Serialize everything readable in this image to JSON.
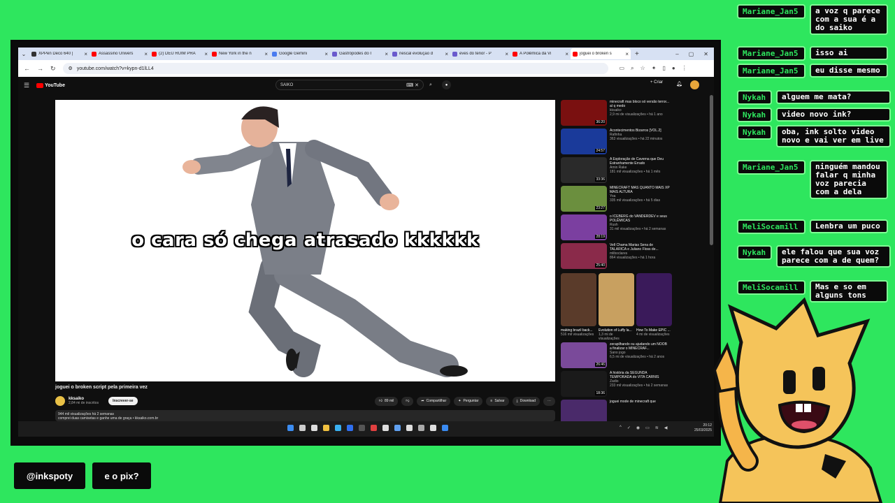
{
  "browser": {
    "tabs": [
      {
        "label": "XPPen Deco 640 |",
        "color": "#333"
      },
      {
        "label": "Assassino Univers",
        "color": "#f00"
      },
      {
        "label": "(2) DEU RUIM PRA",
        "color": "#f00"
      },
      {
        "label": "New York in the n",
        "color": "#f00"
      },
      {
        "label": "Google Gemini",
        "color": "#4a7cf0"
      },
      {
        "label": "Gastrópodes do I",
        "color": "#6a5acd"
      },
      {
        "label": "nescal evolução d",
        "color": "#6a5acd"
      },
      {
        "label": "eves do tenor - P",
        "color": "#6a5acd"
      },
      {
        "label": "A Polêmica da Vi",
        "color": "#f00"
      },
      {
        "label": "joguei o broken s",
        "color": "#f00",
        "active": true
      }
    ],
    "url": "youtube.com/watch?v=kypn-d1lLL4"
  },
  "youtube": {
    "logo_text": "YouTube",
    "search_value": "SAIKO",
    "create_label": "Criar",
    "video_caption": "o cara só chega atrasado kkkkkk",
    "video_title": "joguei o broken script pela primeira vez",
    "channel_name": "kksaiko",
    "channel_subs": "2,84 mi de inscritos",
    "subscribe_label": "Inscrever-se",
    "like_count": "89 mil",
    "share_label": "Compartilhar",
    "ask_label": "Perguntar",
    "save_label": "Salvar",
    "download_label": "Download",
    "description_line1": "944 mil visualizações  há 2 semanas",
    "description_line2": "comprei duas camisetas e ganhe uma de graça • kksaiko.com.br",
    "recommendations": [
      {
        "title": "minecraft mas bloco só versão terror... aí q medo",
        "channel": "kksaiko",
        "views": "2,9 mi de visualizações • há 1 ano",
        "thumb": "#7a1010",
        "duration": "36:20"
      },
      {
        "title": "Acontecimentos Bizarros [VOL.2]",
        "channel": "Rafinha",
        "views": "363 visualizações • há 22 minutos",
        "thumb": "#1a3a9a",
        "duration": "24:57"
      },
      {
        "title": "A Exploração de Caverna que Deu Estranhamente Errado",
        "channel": "Amin Rake",
        "views": "181 mil visualizações • há 1 mês",
        "thumb": "#2a2a2a",
        "duration": "33:36"
      },
      {
        "title": "MINECRAFT MAS QUANTO MAIS XP MAIS ALTURA",
        "channel": "Yoa",
        "views": "335 mil visualizações • há 5 dias",
        "thumb": "#6b8f3e",
        "duration": "23:27"
      },
      {
        "title": "o ICEBERG do VANDERDEV e seus POLÊMICAS",
        "channel": "Rush",
        "views": "31 mil visualizações • há 2 semanas",
        "thumb": "#7b3fa0",
        "duration": "28:19"
      },
      {
        "title": "Vell Chama Marias Sena de TALARICA e Juliano Floss de...",
        "channel": "mliboclares",
        "views": "864 visualizações • há 1 hora",
        "thumb": "#8a2a4a",
        "duration": "25:40"
      }
    ],
    "shorts": [
      {
        "title": "making brazil back...",
        "views": "516 mil visualizações",
        "thumb": "#5a3b2a"
      },
      {
        "title": "Evolution of Luffy la...",
        "views": "1,3 mi de visualizações",
        "thumb": "#c8a060"
      },
      {
        "title": "How To Make EPIC ...",
        "views": "4 mi de visualizações",
        "thumb": "#3a1a5a"
      }
    ],
    "recommendations_bottom": [
      {
        "title": "zerapilhando ou ajudando um NOOB a finalizar o MINECRAF...",
        "channel": "Sano jogo",
        "views": "6,5 mi de visualizações • há 2 anos",
        "thumb": "#7a4a9a",
        "duration": "26:46"
      },
      {
        "title": "A história da SEGUNDA TEMPORADA do VITA CARNIS",
        "channel": "Zadio",
        "views": "233 mil visualizações • há 2 semanas",
        "thumb": "#1a1a1a",
        "duration": "18:36"
      },
      {
        "title": "joguei mode de minecraft que",
        "channel": "",
        "views": "",
        "thumb": "#4a2a6a",
        "duration": ""
      }
    ]
  },
  "taskbar": {
    "time": "20:12",
    "date": "25/03/2025"
  },
  "chat": [
    {
      "user": "Mariane_Jan5",
      "message": "a voz q parece com a sua é a do saiko"
    },
    {
      "user": "Mariane_Jan5",
      "message": "isso ai"
    },
    {
      "user": "Mariane_Jan5",
      "message": "eu disse mesmo"
    },
    {
      "user": "Nykah",
      "message": "alguem me mata?"
    },
    {
      "user": "Nykah",
      "message": "video novo ink?"
    },
    {
      "user": "Nykah",
      "message": "oba, ink solto video novo e vai ver em live"
    },
    {
      "user": "Mariane_Jan5",
      "message": "ninguém mandou falar q minha voz parecia com a dela"
    },
    {
      "user": "MeliSocamill",
      "message": "Lenbra um puco"
    },
    {
      "user": "Nykah",
      "message": "ele falou que sua voz parece com a de quem?"
    },
    {
      "user": "MeliSocamill",
      "message": "Mas e so em alguns tons"
    }
  ],
  "overlay": {
    "handle": "@inkspoty",
    "pix": "e o pix?"
  },
  "colors": {
    "background": "#2ee65e",
    "chat_user": "#2ee65e",
    "chat_border": "#7dff93"
  }
}
